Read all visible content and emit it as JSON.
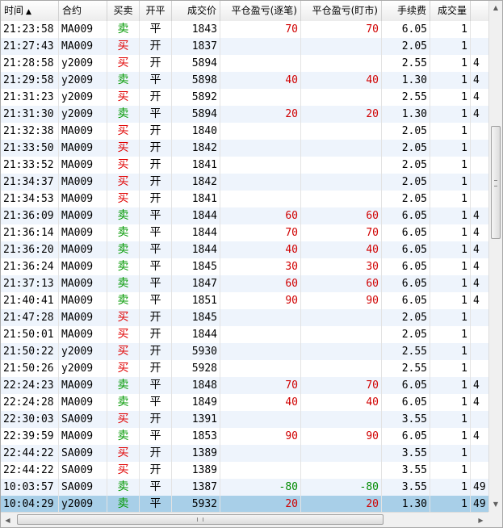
{
  "columns": [
    {
      "key": "time",
      "label": "时间",
      "sort_icon": "sort-ascending-icon",
      "sort_glyph": "▲"
    },
    {
      "key": "contract",
      "label": "合约"
    },
    {
      "key": "side",
      "label": "买卖"
    },
    {
      "key": "open_close",
      "label": "开平"
    },
    {
      "key": "price",
      "label": "成交价"
    },
    {
      "key": "pnl_trade",
      "label": "平仓盈亏(逐笔)"
    },
    {
      "key": "pnl_mark",
      "label": "平仓盈亏(盯市)"
    },
    {
      "key": "fee",
      "label": "手续费"
    },
    {
      "key": "volume",
      "label": "成交量"
    },
    {
      "key": "extra",
      "label": ""
    }
  ],
  "rows": [
    {
      "time": "21:23:58",
      "contract": "MA009",
      "side": "卖",
      "open_close": "平",
      "price": "1843",
      "pnl_trade": "70",
      "pnl_mark": "70",
      "fee": "6.05",
      "volume": "1",
      "extra": ""
    },
    {
      "time": "21:27:43",
      "contract": "MA009",
      "side": "买",
      "open_close": "开",
      "price": "1837",
      "pnl_trade": "",
      "pnl_mark": "",
      "fee": "2.05",
      "volume": "1",
      "extra": ""
    },
    {
      "time": "21:28:58",
      "contract": "y2009",
      "side": "买",
      "open_close": "开",
      "price": "5894",
      "pnl_trade": "",
      "pnl_mark": "",
      "fee": "2.55",
      "volume": "1",
      "extra": "4"
    },
    {
      "time": "21:29:58",
      "contract": "y2009",
      "side": "卖",
      "open_close": "平",
      "price": "5898",
      "pnl_trade": "40",
      "pnl_mark": "40",
      "fee": "1.30",
      "volume": "1",
      "extra": "4"
    },
    {
      "time": "21:31:23",
      "contract": "y2009",
      "side": "买",
      "open_close": "开",
      "price": "5892",
      "pnl_trade": "",
      "pnl_mark": "",
      "fee": "2.55",
      "volume": "1",
      "extra": "4"
    },
    {
      "time": "21:31:30",
      "contract": "y2009",
      "side": "卖",
      "open_close": "平",
      "price": "5894",
      "pnl_trade": "20",
      "pnl_mark": "20",
      "fee": "1.30",
      "volume": "1",
      "extra": "4"
    },
    {
      "time": "21:32:38",
      "contract": "MA009",
      "side": "买",
      "open_close": "开",
      "price": "1840",
      "pnl_trade": "",
      "pnl_mark": "",
      "fee": "2.05",
      "volume": "1",
      "extra": ""
    },
    {
      "time": "21:33:50",
      "contract": "MA009",
      "side": "买",
      "open_close": "开",
      "price": "1842",
      "pnl_trade": "",
      "pnl_mark": "",
      "fee": "2.05",
      "volume": "1",
      "extra": ""
    },
    {
      "time": "21:33:52",
      "contract": "MA009",
      "side": "买",
      "open_close": "开",
      "price": "1841",
      "pnl_trade": "",
      "pnl_mark": "",
      "fee": "2.05",
      "volume": "1",
      "extra": ""
    },
    {
      "time": "21:34:37",
      "contract": "MA009",
      "side": "买",
      "open_close": "开",
      "price": "1842",
      "pnl_trade": "",
      "pnl_mark": "",
      "fee": "2.05",
      "volume": "1",
      "extra": ""
    },
    {
      "time": "21:34:53",
      "contract": "MA009",
      "side": "买",
      "open_close": "开",
      "price": "1841",
      "pnl_trade": "",
      "pnl_mark": "",
      "fee": "2.05",
      "volume": "1",
      "extra": ""
    },
    {
      "time": "21:36:09",
      "contract": "MA009",
      "side": "卖",
      "open_close": "平",
      "price": "1844",
      "pnl_trade": "60",
      "pnl_mark": "60",
      "fee": "6.05",
      "volume": "1",
      "extra": "4"
    },
    {
      "time": "21:36:14",
      "contract": "MA009",
      "side": "卖",
      "open_close": "平",
      "price": "1844",
      "pnl_trade": "70",
      "pnl_mark": "70",
      "fee": "6.05",
      "volume": "1",
      "extra": "4"
    },
    {
      "time": "21:36:20",
      "contract": "MA009",
      "side": "卖",
      "open_close": "平",
      "price": "1844",
      "pnl_trade": "40",
      "pnl_mark": "40",
      "fee": "6.05",
      "volume": "1",
      "extra": "4"
    },
    {
      "time": "21:36:24",
      "contract": "MA009",
      "side": "卖",
      "open_close": "平",
      "price": "1845",
      "pnl_trade": "30",
      "pnl_mark": "30",
      "fee": "6.05",
      "volume": "1",
      "extra": "4"
    },
    {
      "time": "21:37:13",
      "contract": "MA009",
      "side": "卖",
      "open_close": "平",
      "price": "1847",
      "pnl_trade": "60",
      "pnl_mark": "60",
      "fee": "6.05",
      "volume": "1",
      "extra": "4"
    },
    {
      "time": "21:40:41",
      "contract": "MA009",
      "side": "卖",
      "open_close": "平",
      "price": "1851",
      "pnl_trade": "90",
      "pnl_mark": "90",
      "fee": "6.05",
      "volume": "1",
      "extra": "4"
    },
    {
      "time": "21:47:28",
      "contract": "MA009",
      "side": "买",
      "open_close": "开",
      "price": "1845",
      "pnl_trade": "",
      "pnl_mark": "",
      "fee": "2.05",
      "volume": "1",
      "extra": ""
    },
    {
      "time": "21:50:01",
      "contract": "MA009",
      "side": "买",
      "open_close": "开",
      "price": "1844",
      "pnl_trade": "",
      "pnl_mark": "",
      "fee": "2.05",
      "volume": "1",
      "extra": ""
    },
    {
      "time": "21:50:22",
      "contract": "y2009",
      "side": "买",
      "open_close": "开",
      "price": "5930",
      "pnl_trade": "",
      "pnl_mark": "",
      "fee": "2.55",
      "volume": "1",
      "extra": ""
    },
    {
      "time": "21:50:26",
      "contract": "y2009",
      "side": "买",
      "open_close": "开",
      "price": "5928",
      "pnl_trade": "",
      "pnl_mark": "",
      "fee": "2.55",
      "volume": "1",
      "extra": ""
    },
    {
      "time": "22:24:23",
      "contract": "MA009",
      "side": "卖",
      "open_close": "平",
      "price": "1848",
      "pnl_trade": "70",
      "pnl_mark": "70",
      "fee": "6.05",
      "volume": "1",
      "extra": "4"
    },
    {
      "time": "22:24:28",
      "contract": "MA009",
      "side": "卖",
      "open_close": "平",
      "price": "1849",
      "pnl_trade": "40",
      "pnl_mark": "40",
      "fee": "6.05",
      "volume": "1",
      "extra": "4"
    },
    {
      "time": "22:30:03",
      "contract": "SA009",
      "side": "买",
      "open_close": "开",
      "price": "1391",
      "pnl_trade": "",
      "pnl_mark": "",
      "fee": "3.55",
      "volume": "1",
      "extra": ""
    },
    {
      "time": "22:39:59",
      "contract": "MA009",
      "side": "卖",
      "open_close": "平",
      "price": "1853",
      "pnl_trade": "90",
      "pnl_mark": "90",
      "fee": "6.05",
      "volume": "1",
      "extra": "4"
    },
    {
      "time": "22:44:22",
      "contract": "SA009",
      "side": "买",
      "open_close": "开",
      "price": "1389",
      "pnl_trade": "",
      "pnl_mark": "",
      "fee": "3.55",
      "volume": "1",
      "extra": ""
    },
    {
      "time": "22:44:22",
      "contract": "SA009",
      "side": "买",
      "open_close": "开",
      "price": "1389",
      "pnl_trade": "",
      "pnl_mark": "",
      "fee": "3.55",
      "volume": "1",
      "extra": ""
    },
    {
      "time": "10:03:57",
      "contract": "SA009",
      "side": "卖",
      "open_close": "平",
      "price": "1387",
      "pnl_trade": "-80",
      "pnl_mark": "-80",
      "fee": "3.55",
      "volume": "1",
      "extra": "49"
    },
    {
      "time": "10:04:29",
      "contract": "y2009",
      "side": "卖",
      "open_close": "平",
      "price": "5932",
      "pnl_trade": "20",
      "pnl_mark": "20",
      "fee": "1.30",
      "volume": "1",
      "extra": "49",
      "selected": true
    }
  ],
  "scrollbars": {
    "vertical": {
      "up_icon": "scroll-up-arrow-icon",
      "down_icon": "scroll-down-arrow-icon",
      "up_glyph": "▲",
      "down_glyph": "▼"
    },
    "horizontal": {
      "left_icon": "scroll-left-arrow-icon",
      "right_icon": "scroll-right-arrow-icon",
      "left_glyph": "◀",
      "right_glyph": "▶"
    }
  },
  "colors": {
    "buy": "#e00000",
    "sell": "#009900",
    "profit": "#d00000",
    "loss": "#008a00",
    "row_alt": "#eef4fc",
    "row_selected": "#a8cfe8"
  }
}
